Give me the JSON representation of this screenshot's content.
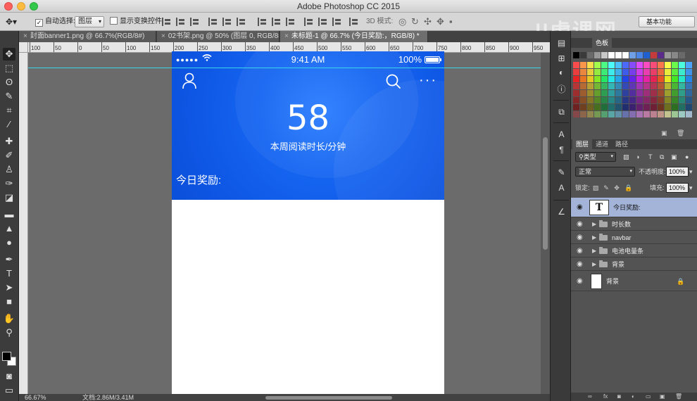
{
  "app": {
    "title": "Adobe Photoshop CC 2015"
  },
  "options_bar": {
    "auto_select_label": "自动选择:",
    "auto_select_checked": true,
    "auto_select_value": "图层",
    "show_transform_label": "显示变换控件",
    "mode_3d_label": "3D 模式:",
    "workspace_value": "基本功能"
  },
  "tabs": [
    {
      "label": "封面banner1.png @ 66.7%(RGB/8#)",
      "active": false
    },
    {
      "label": "02书架.png @ 50% (图层 0, RGB/8#)",
      "active": false
    },
    {
      "label": "未标题-1 @ 66.7% (今日奖励:，RGB/8) *",
      "active": true
    }
  ],
  "ruler": {
    "ticks": [
      "100",
      "50",
      "0",
      "50",
      "100",
      "150",
      "200",
      "250",
      "300",
      "350",
      "400",
      "450",
      "500",
      "550",
      "600",
      "650",
      "700",
      "750",
      "800",
      "850",
      "900",
      "950"
    ]
  },
  "phone": {
    "status_dots": "●●●●●",
    "time": "9:41 AM",
    "battery_pct": "100%",
    "big_number": "58",
    "sub_label": "本周阅读时长/分钟",
    "reward_label": "今日奖励:",
    "more_label": "···"
  },
  "statusbar": {
    "zoom": "66.67%",
    "doc_info": "文档:2.86M/3.41M"
  },
  "panels": {
    "top_tabs": [
      "色板"
    ],
    "layer_tabs": [
      "图层",
      "通道",
      "路径"
    ],
    "kind_filter": "类型",
    "blend_mode": "正常",
    "opacity_label": "不透明度:",
    "opacity_value": "100%",
    "lock_label": "锁定:",
    "fill_label": "填充:",
    "fill_value": "100%"
  },
  "layers": [
    {
      "name": "今日奖励:",
      "type": "text",
      "selected": true
    },
    {
      "name": "时长数",
      "type": "group",
      "selected": false
    },
    {
      "name": "navbar",
      "type": "group",
      "selected": false
    },
    {
      "name": "电池电量条",
      "type": "group",
      "selected": false
    },
    {
      "name": "背景",
      "type": "group",
      "selected": false
    },
    {
      "name": "背景",
      "type": "background",
      "selected": false
    }
  ],
  "colors": {
    "hero_blue": "#1666f2",
    "guide_cyan": "#38d6e6",
    "selected_layer": "#a3b4d8"
  }
}
